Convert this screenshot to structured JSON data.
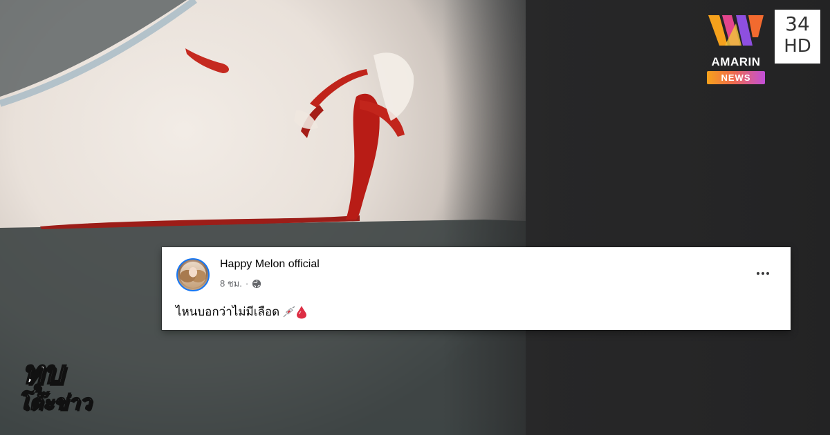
{
  "broadcaster": {
    "brand": "AMARIN",
    "badge": "NEWS",
    "channel_number": "34",
    "channel_suffix": "HD",
    "colors": {
      "badge_start": "#f7a21b",
      "badge_mid": "#ef6c4c",
      "badge_end": "#c24fd9",
      "mark_orange": "#f5a11c",
      "mark_pink": "#e2458c",
      "mark_purple": "#8e4fe0"
    }
  },
  "post": {
    "page_name": "Happy Melon official",
    "time_ago": "8 ชม.",
    "separator": "·",
    "privacy_icon": "globe-icon",
    "more_icon": "more-options-icon",
    "text": "ไหนบอกว่าไม่มีเลือด",
    "emojis": [
      "syringe-icon",
      "drop-of-blood-icon"
    ]
  },
  "show": {
    "line1": "ทุบ",
    "line2": "โต๊ะข่าว"
  },
  "photo": {
    "blood_color": "#c8201a"
  }
}
